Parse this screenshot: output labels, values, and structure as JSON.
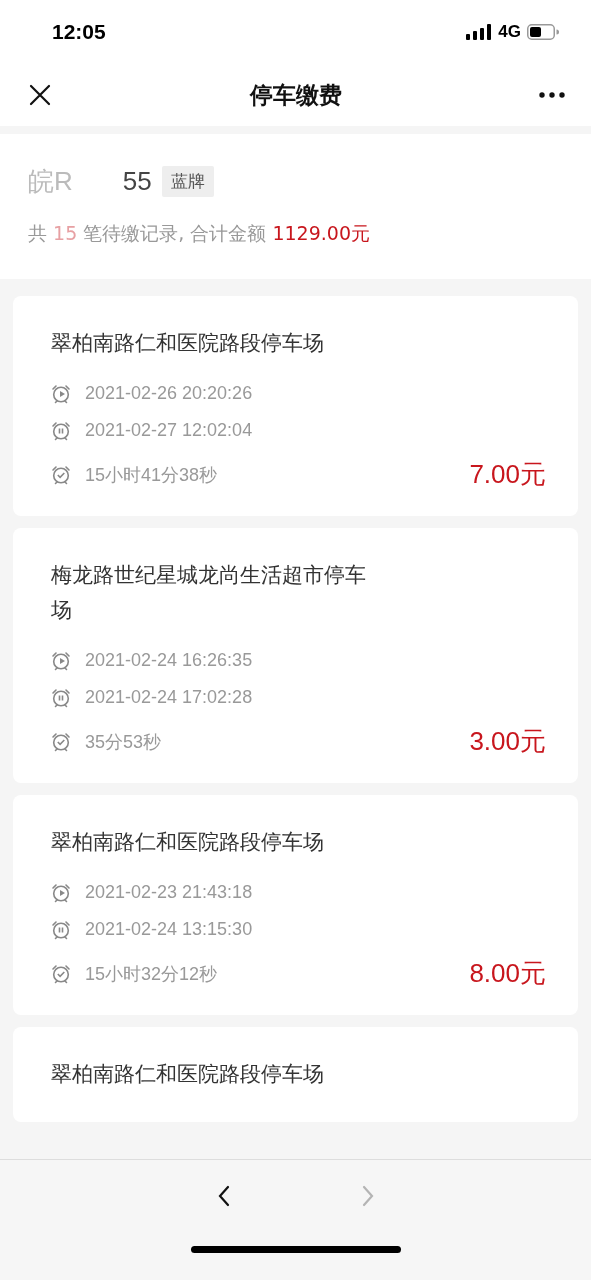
{
  "status_bar": {
    "time": "12:05",
    "network": "4G"
  },
  "nav_bar": {
    "title": "停车缴费"
  },
  "vehicle": {
    "plate_start": "皖R",
    "plate_end": "55",
    "plate_type": "蓝牌",
    "summary_prefix": "共",
    "count": "15",
    "summary_middle": "笔待缴记录, 合计金额",
    "total": "1129.00元"
  },
  "records": [
    {
      "location": "翠柏南路仁和医院路段停车场",
      "start": "2021-02-26 20:20:26",
      "end": "2021-02-27 12:02:04",
      "duration": "15小时41分38秒",
      "fee": "7.00元"
    },
    {
      "location": "梅龙路世纪星城龙尚生活超市停车场",
      "start": "2021-02-24 16:26:35",
      "end": "2021-02-24 17:02:28",
      "duration": "35分53秒",
      "fee": "3.00元"
    },
    {
      "location": "翠柏南路仁和医院路段停车场",
      "start": "2021-02-23 21:43:18",
      "end": "2021-02-24 13:15:30",
      "duration": "15小时32分12秒",
      "fee": "8.00元"
    },
    {
      "location": "翠柏南路仁和医院路段停车场"
    }
  ],
  "toolbar": [
    {
      "kind": "back",
      "disabled": false
    },
    {
      "kind": "forward",
      "disabled": true
    }
  ]
}
